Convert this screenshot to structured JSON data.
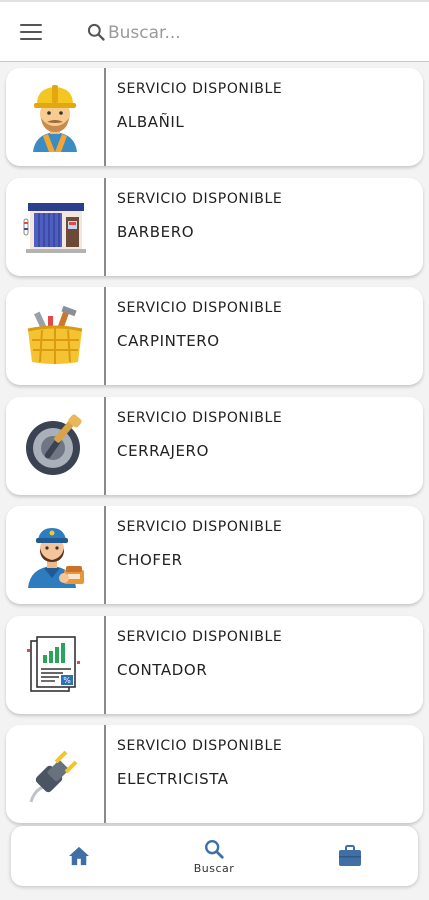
{
  "header": {
    "search_placeholder": "Buscar..."
  },
  "services": [
    {
      "status": "SERVICIO DISPONIBLE",
      "name": "ALBAÑIL",
      "icon": "construction-worker-icon"
    },
    {
      "status": "SERVICIO DISPONIBLE",
      "name": "BARBERO",
      "icon": "barber-shop-icon"
    },
    {
      "status": "SERVICIO DISPONIBLE",
      "name": "CARPINTERO",
      "icon": "toolbox-icon"
    },
    {
      "status": "SERVICIO DISPONIBLE",
      "name": "CERRAJERO",
      "icon": "lock-key-icon"
    },
    {
      "status": "SERVICIO DISPONIBLE",
      "name": "CHOFER",
      "icon": "driver-icon"
    },
    {
      "status": "SERVICIO DISPONIBLE",
      "name": "CONTADOR",
      "icon": "accounting-report-icon"
    },
    {
      "status": "SERVICIO DISPONIBLE",
      "name": "ELECTRICISTA",
      "icon": "electric-plug-icon"
    }
  ],
  "bottom_nav": {
    "search_label": "Buscar"
  },
  "colors": {
    "nav_accent": "#3f6fa5",
    "divider": "#8a8a8a",
    "background": "#f3f3f3"
  }
}
